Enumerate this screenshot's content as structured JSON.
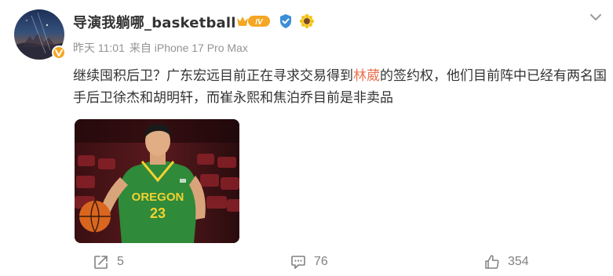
{
  "post": {
    "author": {
      "name": "导演我躺哪_basketball",
      "level_badge": "IV"
    },
    "meta": {
      "time": "昨天 11:01",
      "source": "来自 iPhone 17 Pro Max"
    },
    "text": {
      "before_highlight": "继续囤积后卫？广东宏远目前正在寻求交易得到",
      "highlight": "林葳",
      "after_highlight": "的签约权，他们目前阵中已经有两名国手后卫徐杰和胡明轩，而崔永熙和焦泊乔目前是非卖品"
    },
    "image": {
      "jersey_team": "OREGON",
      "jersey_number": "23"
    },
    "actions": {
      "repost_count": "5",
      "comment_count": "76",
      "like_count": "354"
    }
  },
  "colors": {
    "highlight": "#eb7350",
    "text": "#333333",
    "meta": "#939393",
    "verify": "#3b8fd6",
    "level_badge": "#f5a623",
    "jersey": "#2f8a3a",
    "jersey_text": "#f2d230"
  },
  "icons": {
    "avatar_badge": "gold-v-badge-icon",
    "level": "crown-level-badge-icon",
    "verify": "verified-shield-icon",
    "sun": "sun-flower-icon",
    "menu": "chevron-down-icon",
    "repost": "repost-icon",
    "comment": "comment-icon",
    "like": "thumbs-up-icon"
  }
}
